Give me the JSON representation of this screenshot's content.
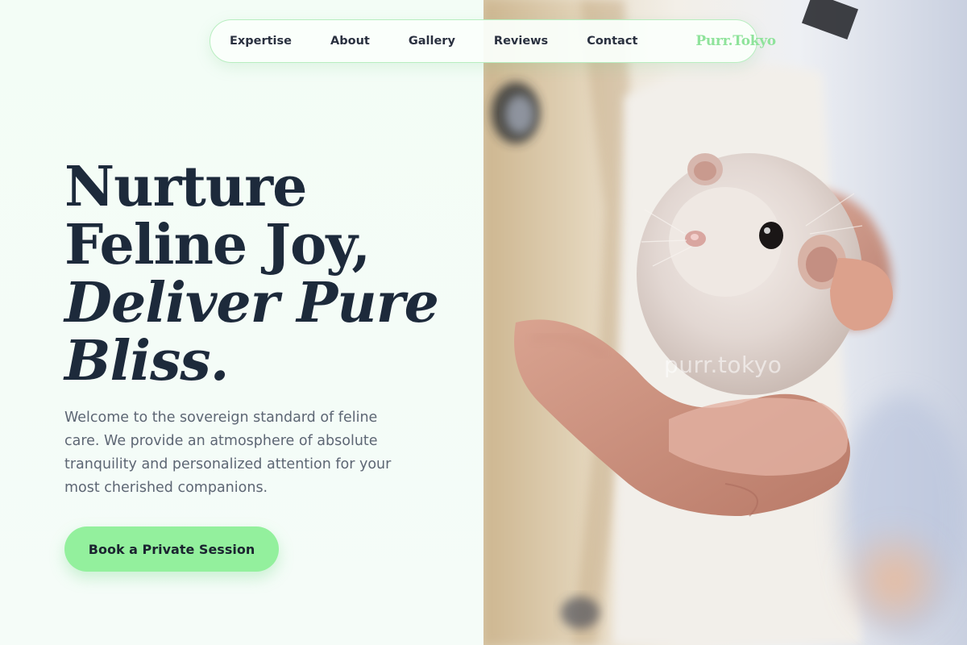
{
  "nav": {
    "links": [
      "Expertise",
      "About",
      "Gallery",
      "Reviews",
      "Contact"
    ],
    "brand": "Purr.Tokyo"
  },
  "hero": {
    "headline_lines": [
      "Nurture",
      "Feline Joy,"
    ],
    "headline_italic_lines": [
      "Deliver Pure",
      "Bliss."
    ],
    "intro": "Welcome to the sovereign standard of feline care. We provide an atmosphere of absolute tranquility and personalized attention for your most cherished companions.",
    "cta_label": "Book a Private Session"
  },
  "photo": {
    "watermark": "purr.tokyo",
    "subject": "hamster-in-hand-photo"
  },
  "colors": {
    "accent_green": "#93f09d",
    "brand_green": "#8fe39b",
    "headline": "#1d2a3b",
    "body_text": "#5d6674",
    "background": "#f3fcf6"
  }
}
